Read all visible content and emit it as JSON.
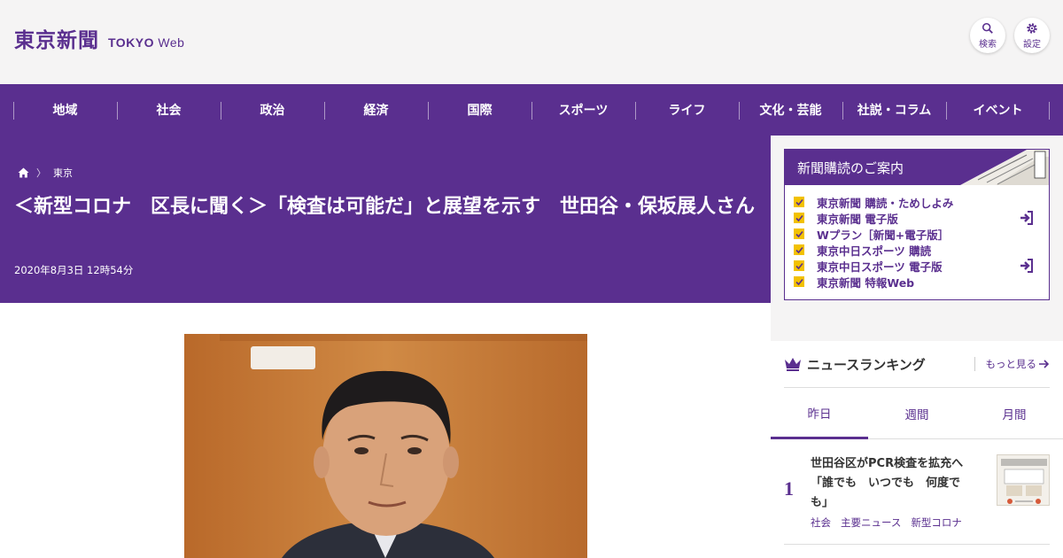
{
  "header": {
    "logo_kanji": "東京新聞",
    "logo_en_bold": "TOKYO",
    "logo_en_light": "Web",
    "search_label": "検索",
    "settings_label": "設定"
  },
  "nav": {
    "items": [
      "地域",
      "社会",
      "政治",
      "経済",
      "国際",
      "スポーツ",
      "ライフ",
      "文化・芸能",
      "社説・コラム",
      "イベント"
    ]
  },
  "article": {
    "breadcrumb_section": "東京",
    "headline": "＜新型コロナ　区長に聞く＞「検査は可能だ」と展望を示す　世田谷・保坂展人さん",
    "date": "2020年8月3日 12時54分"
  },
  "subscription": {
    "title": "新聞購読のご案内",
    "items": [
      "東京新聞 購読・ためしよみ",
      "東京新聞 電子版",
      "Wプラン［新聞+電子版］",
      "東京中日スポーツ 購読",
      "東京中日スポーツ 電子版",
      "東京新聞 特報Web"
    ]
  },
  "ranking": {
    "title": "ニュースランキング",
    "more": "もっと見る",
    "tabs": [
      "昨日",
      "週間",
      "月間"
    ],
    "item": {
      "rank": "1",
      "title": "世田谷区がPCR検査を拡充へ「誰でも　いつでも　何度でも」",
      "tags": [
        "社会",
        "主要ニュース",
        "新型コロナ"
      ]
    }
  },
  "colors": {
    "brand_purple": "#5a2f8f",
    "check_yellow": "#f2c100",
    "background": "#f5f4f4"
  }
}
